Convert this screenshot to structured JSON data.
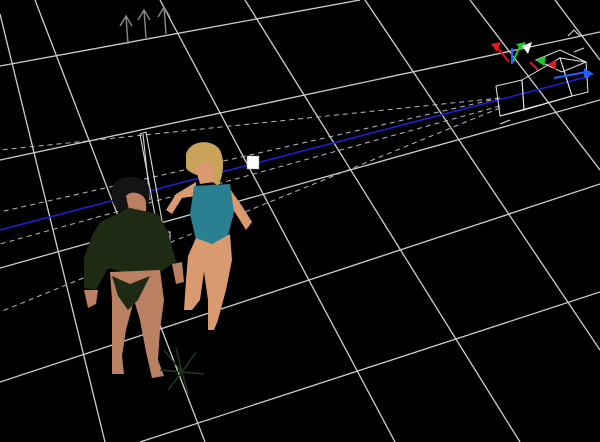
{
  "viewport": {
    "background": "#000000",
    "grid_color": "#cfcfcf",
    "frustum_color": "#b8b8b8",
    "sight_line_color": "#2020d0"
  },
  "camera_gizmo": {
    "axis_colors": {
      "x": "#e01818",
      "y": "#1ec81e",
      "z": "#2060ff"
    },
    "wireframe_color": "#e6e6e6"
  },
  "light_gizmo": {
    "icon": "spotlight-icon",
    "color": "#d8d8d8"
  },
  "figures": [
    {
      "name": "male-figure",
      "clothing": "#1f2a14",
      "skin": "#b98062",
      "hair": "#141414"
    },
    {
      "name": "female-figure",
      "clothing": "#2a7f90",
      "skin": "#d89a6e",
      "hair": "#c9a25a"
    }
  ],
  "props": [
    {
      "name": "plant-prop",
      "color": "#1e3a1e"
    },
    {
      "name": "direction-arrows",
      "icon": "arrow-up-icon",
      "color": "#8a8a8a"
    }
  ]
}
